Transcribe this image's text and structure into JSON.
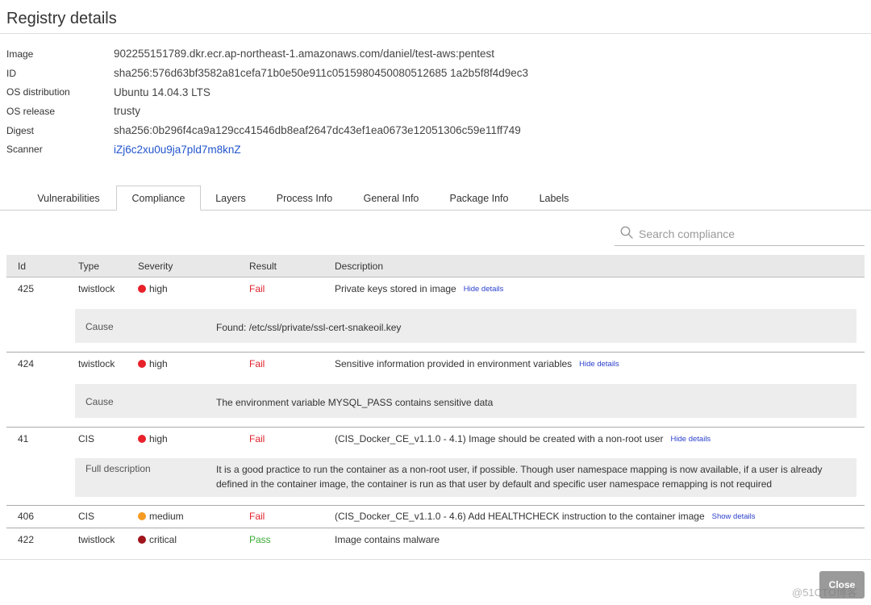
{
  "dialog": {
    "title": "Registry details"
  },
  "details": [
    {
      "label": "Image",
      "value": "902255151789.dkr.ecr.ap-northeast-1.amazonaws.com/daniel/test-aws:pentest"
    },
    {
      "label": "ID",
      "value": "sha256:576d63bf3582a81cefa71b0e50e911c0515980450080512685 1a2b5f8f4d9ec3"
    },
    {
      "label": "OS distribution",
      "value": "Ubuntu 14.04.3 LTS"
    },
    {
      "label": "OS release",
      "value": "trusty"
    },
    {
      "label": "Digest",
      "value": "sha256:0b296f4ca9a129cc41546db8eaf2647dc43ef1ea0673e12051306c59e11ff749"
    },
    {
      "label": "Scanner",
      "value": "iZj6c2xu0u9ja7pld7m8knZ"
    }
  ],
  "tabs": [
    "Vulnerabilities",
    "Compliance",
    "Layers",
    "Process Info",
    "General Info",
    "Package Info",
    "Labels"
  ],
  "search": {
    "placeholder": "Search compliance"
  },
  "table": {
    "headers": [
      "Id",
      "Type",
      "Severity",
      "Result",
      "Description"
    ],
    "rows": [
      {
        "id": "425",
        "type": "twistlock",
        "severity": "high",
        "result": "Fail",
        "description": "Private keys stored in image",
        "toggle": "Hide details",
        "detail_label": "Cause",
        "detail_text": "Found: /etc/ssl/private/ssl-cert-snakeoil.key"
      },
      {
        "id": "424",
        "type": "twistlock",
        "severity": "high",
        "result": "Fail",
        "description": "Sensitive information provided in environment variables",
        "toggle": "Hide details",
        "detail_label": "Cause",
        "detail_text": "The environment variable MYSQL_PASS contains sensitive data"
      },
      {
        "id": "41",
        "type": "CIS",
        "severity": "high",
        "result": "Fail",
        "description": "(CIS_Docker_CE_v1.1.0 - 4.1) Image should be created with a non-root user",
        "toggle": "Hide details",
        "detail_label": "Full description",
        "detail_text": "It is a good practice to run the container as a non-root user, if possible. Though user namespace mapping is now available, if a user is already defined in the container image, the container is run as that user by default and specific user namespace remapping is not required"
      },
      {
        "id": "406",
        "type": "CIS",
        "severity": "medium",
        "result": "Fail",
        "description": "(CIS_Docker_CE_v1.1.0 - 4.6) Add HEALTHCHECK instruction to the container image",
        "toggle": "Show details"
      },
      {
        "id": "422",
        "type": "twistlock",
        "severity": "critical",
        "result": "Pass",
        "description": "Image contains malware"
      }
    ]
  },
  "colors": {
    "high": "#e8212b",
    "medium": "#f59a23",
    "critical": "#a0141c",
    "fail": "#e0212d",
    "pass": "#3aaa35",
    "link": "#2a3fcc"
  },
  "footer": {
    "close_label": "Close",
    "watermark": "@51CTO博客"
  }
}
